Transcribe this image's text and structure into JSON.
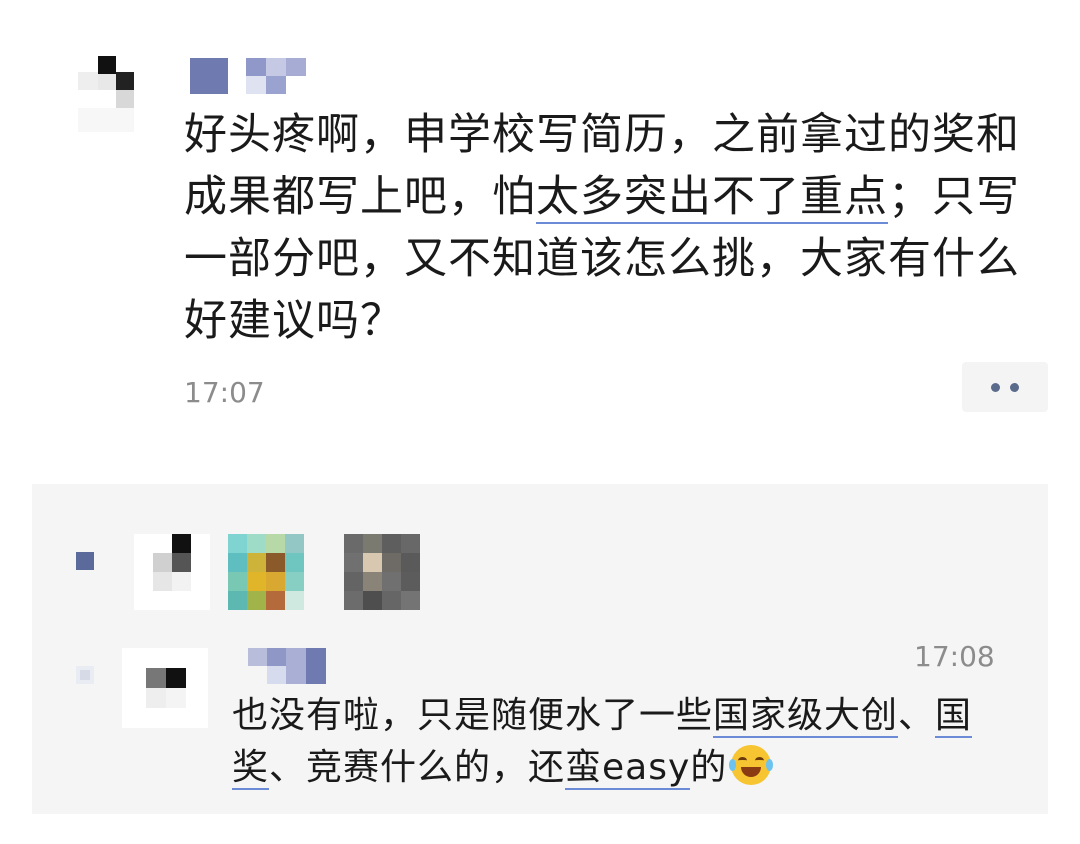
{
  "post": {
    "text_parts": [
      "好头疼啊，申学校写简历，之前拿过的奖和成果都写上吧，怕",
      "太多突出不了重点",
      "；只写一部分吧，又不知道该怎么挑，大家有什么好建议吗？"
    ],
    "time": "17:07",
    "more_icon": "more-dots-icon"
  },
  "likes": {
    "icon": "like-icon",
    "count_visible": 3
  },
  "comment": {
    "time": "17:08",
    "text_parts": [
      "也没有啦，只是随便水了一些",
      "国家级大创",
      "、",
      "国奖",
      "、竞赛什么的，还",
      "蛮easy",
      "的"
    ],
    "emoji": "laughing-tears-emoji"
  },
  "colors": {
    "link_underline": "#6b8bd6",
    "time_text": "#8c8c8c",
    "panel_bg": "#f5f5f5",
    "like_icon": "#5a6a9a"
  }
}
